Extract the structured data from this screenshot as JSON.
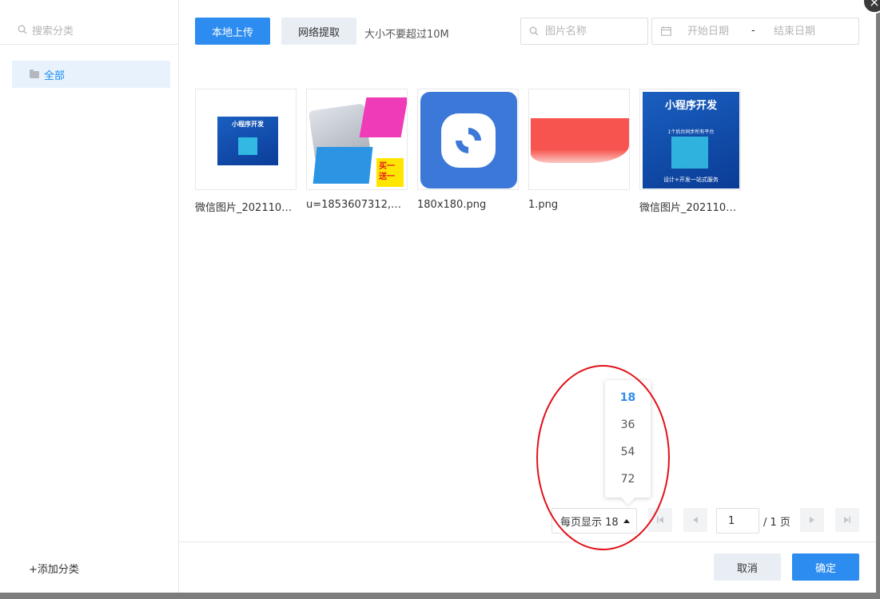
{
  "sidebar": {
    "search_placeholder": "搜索分类",
    "categories": [
      {
        "label": "全部"
      }
    ],
    "add_category": "+添加分类"
  },
  "toolbar": {
    "local_upload": "本地上传",
    "network_fetch": "网络提取",
    "size_hint": "大小不要超过10M",
    "name_placeholder": "图片名称",
    "start_date_placeholder": "开始日期",
    "date_separator": "-",
    "end_date_placeholder": "结束日期"
  },
  "images": [
    {
      "name": "微信图片_2021100...",
      "thumb_text": "小程序开发"
    },
    {
      "name": "u=1853607312,39...",
      "thumb_text": "买一送一"
    },
    {
      "name": "180x180.png"
    },
    {
      "name": "1.png"
    },
    {
      "name": "微信图片_2021100...",
      "thumb_text": "小程序开发",
      "thumb_sub": "1个后台同步所有平台",
      "thumb_footer": "设计+开发一站式服务"
    }
  ],
  "pagination": {
    "page_size_label": "每页显示 18",
    "page_size_options": [
      "18",
      "36",
      "54",
      "72"
    ],
    "selected_page_size": "18",
    "current_page": "1",
    "total_pages_label": "/ 1 页"
  },
  "footer": {
    "cancel": "取消",
    "confirm": "确定"
  },
  "colors": {
    "primary": "#2d8cf0",
    "annotation": "#e3101a"
  }
}
